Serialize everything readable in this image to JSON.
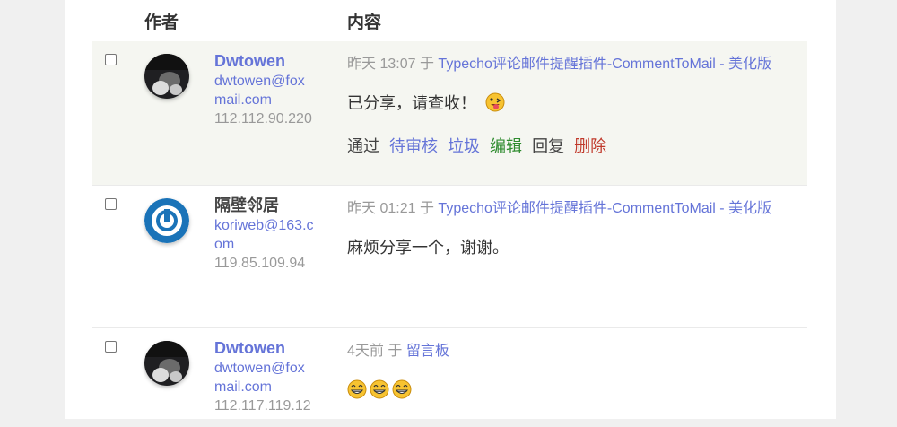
{
  "header": {
    "author": "作者",
    "content": "内容"
  },
  "comments": [
    {
      "author_name": "Dwtowen",
      "email_line1": "dwtowen@fox",
      "email_line2": "mail.com",
      "ip": "112.112.90.220",
      "time": "昨天 13:07",
      "in_word": "于",
      "post_title": "Typecho评论邮件提醒插件-CommentToMail - 美化版",
      "text": "已分享，请查收！",
      "emoji": "tongue-out-emoji",
      "actions": {
        "approve": "通过",
        "pending": "待审核",
        "spam": "垃圾",
        "edit": "编辑",
        "reply": "回复",
        "delete": "删除"
      }
    },
    {
      "author_name": "隔壁邻居",
      "email_line1": "koriweb@163.c",
      "email_line2": "om",
      "ip": "119.85.109.94",
      "time": "昨天 01:21",
      "in_word": "于",
      "post_title": "Typecho评论邮件提醒插件-CommentToMail - 美化版",
      "text": "麻烦分享一个，谢谢。"
    },
    {
      "author_name": "Dwtowen",
      "email_line1": "dwtowen@fox",
      "email_line2": "mail.com",
      "ip": "112.117.119.12",
      "time": "4天前",
      "in_word": "于",
      "post_title": "留言板",
      "emojis": [
        "grin-emoji",
        "grin-emoji",
        "grin-emoji"
      ]
    }
  ],
  "colors": {
    "link": "#6574d8",
    "edit": "#2e8b2e",
    "delete": "#c0392b",
    "highlight_row": "#f5f6f1"
  }
}
